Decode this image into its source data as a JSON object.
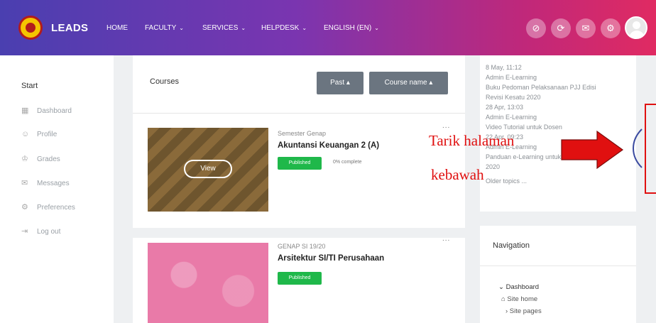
{
  "header": {
    "brand": "LEADS",
    "nav": [
      {
        "label": "HOME",
        "caret": ""
      },
      {
        "label": "FACULTY",
        "caret": "⌄"
      },
      {
        "label": "SERVICES",
        "caret": "⌄"
      },
      {
        "label": "HELPDESK",
        "caret": "⌄"
      },
      {
        "label": "ENGLISH (EN)",
        "caret": "⌄"
      }
    ],
    "icons": [
      "eye-slash-icon",
      "refresh-icon",
      "chat-icon",
      "settings-icon"
    ],
    "colors": {
      "gradient_start": "#4a3fb0",
      "gradient_end": "#e02a62"
    }
  },
  "sidebar": {
    "title": "Start",
    "items": [
      {
        "label": "Dashboard",
        "icon": "dashboard-icon",
        "glyph": "▦"
      },
      {
        "label": "Profile",
        "icon": "profile-icon",
        "glyph": "☺"
      },
      {
        "label": "Grades",
        "icon": "grades-icon",
        "glyph": "♔"
      },
      {
        "label": "Messages",
        "icon": "messages-icon",
        "glyph": "✉"
      },
      {
        "label": "Preferences",
        "icon": "preferences-icon",
        "glyph": "⚙"
      },
      {
        "label": "Log out",
        "icon": "logout-icon",
        "glyph": "⇥"
      }
    ]
  },
  "main": {
    "title": "Courses",
    "filter_past": "Past ▴",
    "filter_sort": "Course name ▴",
    "courses": [
      {
        "category": "Semester Genap",
        "name": "Akuntansi Keuangan 2 (A)",
        "status": "Published",
        "progress": "0% complete",
        "view_label": "View",
        "menu": "..."
      },
      {
        "category": "GENAP SI 19/20",
        "name": "Arsitektur SI/TI Perusahaan",
        "status": "Published",
        "menu": "..."
      }
    ]
  },
  "right_panel": {
    "news": [
      "8 May, 11:12",
      "Admin E-Learning",
      "Buku Pedoman Pelaksanaan PJJ Edisi",
      "Revisi Kesatu 2020",
      "28 Apr, 13:03",
      "Admin E-Learning",
      "Video Tutorial untuk Dosen",
      "22 Apr, 09:23",
      "Admin E-Learning",
      "Panduan e-Learning untuk Mahasiswa",
      "2020",
      "Older topics ..."
    ],
    "navigation": {
      "title": "Navigation",
      "dashboard": "⌄ Dashboard",
      "site_home": "Site home",
      "site_pages": "› Site pages"
    }
  },
  "annotation": {
    "line1": "Tarik halaman",
    "line2": "kebawah",
    "color": "#e01010"
  }
}
